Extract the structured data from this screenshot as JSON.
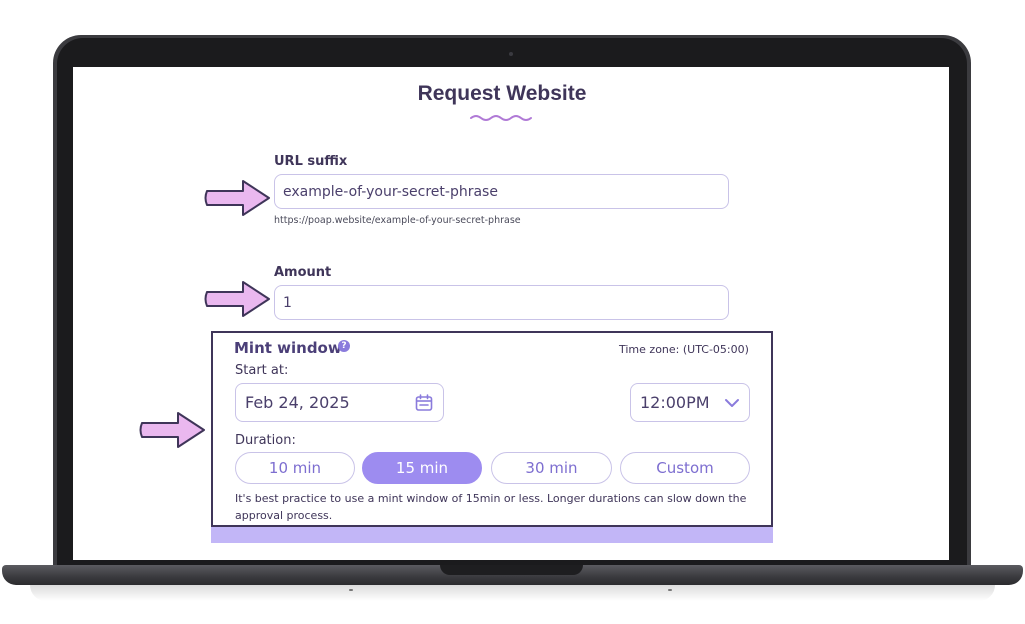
{
  "page": {
    "title": "Request Website"
  },
  "url_suffix": {
    "label": "URL suffix",
    "value": "example-of-your-secret-phrase",
    "preview": "https://poap.website/example-of-your-secret-phrase"
  },
  "amount": {
    "label": "Amount",
    "value": "1"
  },
  "mint_window": {
    "title": "Mint window",
    "timezone": "Time zone: (UTC-05:00)",
    "start_label": "Start at:",
    "start_date": "Feb 24, 2025",
    "start_time": "12:00PM",
    "duration_label": "Duration:",
    "durations": [
      {
        "label": "10 min",
        "selected": false
      },
      {
        "label": "15 min",
        "selected": true
      },
      {
        "label": "30 min",
        "selected": false
      },
      {
        "label": "Custom",
        "selected": false
      }
    ],
    "note": "It's best practice to use a mint window of 15min or less. Longer durations can slow down the approval process."
  },
  "colors": {
    "accent": "#9d8cf0",
    "heading": "#3f3559",
    "arrow_fill": "#eab8ef"
  },
  "icons": [
    "help-icon",
    "calendar-icon",
    "chevron-down-icon",
    "arrow-right-icon"
  ]
}
